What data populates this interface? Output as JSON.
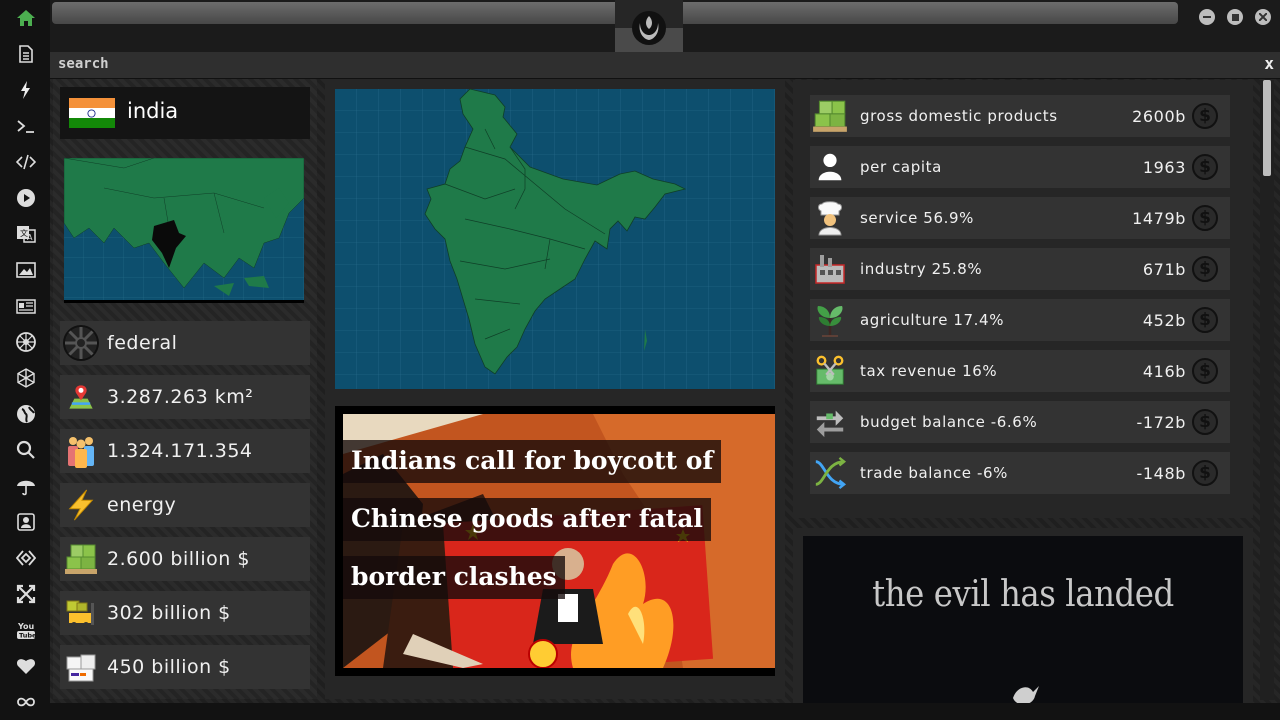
{
  "sidebar": {
    "items": [
      {
        "icon": "home-icon",
        "name": "sidebar-item-home"
      },
      {
        "icon": "document-icon",
        "name": "sidebar-item-documents"
      },
      {
        "icon": "lightning-icon",
        "name": "sidebar-item-energy"
      },
      {
        "icon": "terminal-icon",
        "name": "sidebar-item-terminal"
      },
      {
        "icon": "code-icon",
        "name": "sidebar-item-code"
      },
      {
        "icon": "play-icon",
        "name": "sidebar-item-media"
      },
      {
        "icon": "translate-icon",
        "name": "sidebar-item-translate"
      },
      {
        "icon": "image-icon",
        "name": "sidebar-item-images"
      },
      {
        "icon": "news-icon",
        "name": "sidebar-item-news"
      },
      {
        "icon": "empire-icon",
        "name": "sidebar-item-empire"
      },
      {
        "icon": "hexagon-icon",
        "name": "sidebar-item-hex"
      },
      {
        "icon": "globe-icon",
        "name": "sidebar-item-globe"
      },
      {
        "icon": "search-icon",
        "name": "sidebar-item-search"
      },
      {
        "icon": "umbrella-icon",
        "name": "sidebar-item-weather"
      },
      {
        "icon": "contact-icon",
        "name": "sidebar-item-contacts"
      },
      {
        "icon": "diamond-code-icon",
        "name": "sidebar-item-dev"
      },
      {
        "icon": "expand-icon",
        "name": "sidebar-item-expand"
      },
      {
        "icon": "youtube-icon",
        "name": "sidebar-item-youtube"
      },
      {
        "icon": "heart-icon",
        "name": "sidebar-item-favorites"
      },
      {
        "icon": "infinity-icon",
        "name": "sidebar-item-loop"
      }
    ]
  },
  "search": {
    "label": "search",
    "close": "x"
  },
  "country": {
    "name": "india",
    "flag_colors": [
      "#f4913a",
      "#ffffff",
      "#138808"
    ],
    "government": "federal",
    "area": "3.287.263 km²",
    "population": "1.324.171.354",
    "resource": "energy",
    "gdp": "2.600 billion $",
    "stat_6": "302 billion $",
    "stat_7": "450 billion $"
  },
  "news": {
    "headline": "Indians call for boycott of Chinese goods after fatal border clashes"
  },
  "economy": {
    "rows": [
      {
        "label": "gross domestic products",
        "value": "2600b",
        "icon": "pallet-boxes-icon"
      },
      {
        "label": "per capita",
        "value": "1963",
        "icon": "person-icon"
      },
      {
        "label": "service 56.9%",
        "value": "1479b",
        "icon": "chef-icon"
      },
      {
        "label": "industry 25.8%",
        "value": "671b",
        "icon": "factory-icon"
      },
      {
        "label": "agriculture 17.4%",
        "value": "452b",
        "icon": "plant-icon"
      },
      {
        "label": "tax revenue 16%",
        "value": "416b",
        "icon": "money-scissors-icon"
      },
      {
        "label": "budget balance -6.6%",
        "value": "-172b",
        "icon": "balance-arrows-icon"
      },
      {
        "label": "trade balance -6%",
        "value": "-148b",
        "icon": "trade-cross-icon"
      }
    ],
    "currency_symbol": "$"
  },
  "ad": {
    "text": "the evil has landed"
  },
  "colors": {
    "accent_green": "#4caf50",
    "map_ocean": "#0d4f6e",
    "map_land": "#1f7a49"
  }
}
